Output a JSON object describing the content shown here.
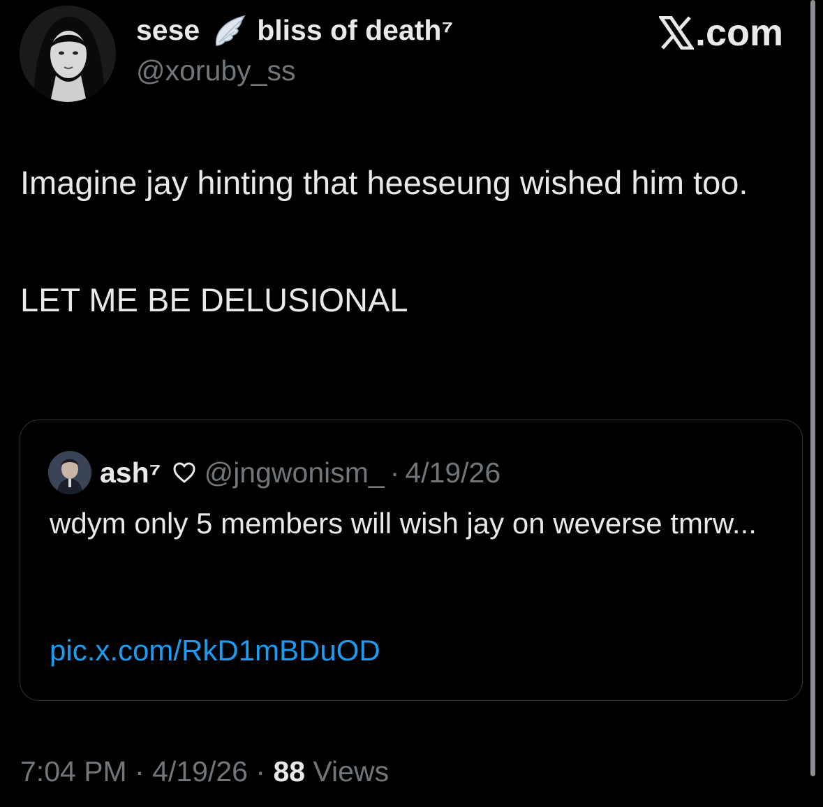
{
  "author": {
    "name_part1": "sese",
    "name_part2": "bliss of death⁷",
    "handle": "@xoruby_ss",
    "name_emoji_icon": "wing-icon",
    "avatar_icon": "profile-photo"
  },
  "site": {
    "label": ".com",
    "logo_icon": "x-logo-icon"
  },
  "tweet": {
    "line1": "Imagine jay hinting that heeseung wished him too.",
    "line2": "LET ME BE DELUSIONAL"
  },
  "quote": {
    "name": "ash⁷",
    "name_icon": "heart-outline-icon",
    "handle": "@jngwonism_",
    "separator": "·",
    "date": "4/19/26",
    "text": "wdym only 5 members will wish jay on weverse tmrw...",
    "link": "pic.x.com/RkD1mBDuOD"
  },
  "meta": {
    "time": "7:04 PM",
    "separator": "·",
    "date": "4/19/26",
    "views_count": "88",
    "views_label": "Views"
  },
  "colors": {
    "background": "#000000",
    "text": "#e7e9ea",
    "muted": "#71767b",
    "link": "#1d9bf0",
    "border": "#2f3336"
  }
}
